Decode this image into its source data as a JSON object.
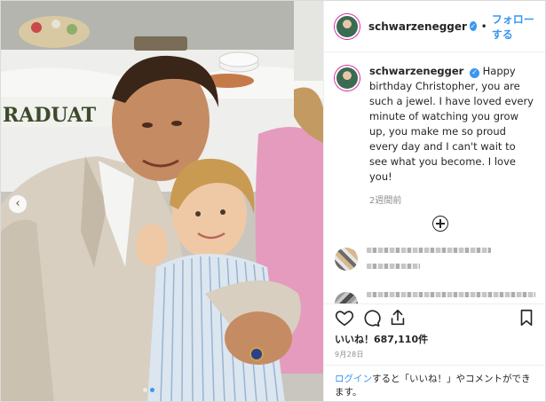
{
  "post": {
    "username": "schwarzenegger",
    "follow_label": "フォローする",
    "separator": "•",
    "caption_text": "Happy birthday Christopher, you are such a jewel. I have loved every minute of watching you grow up, you make me so proud every day and I can't wait to see what you become. I love you!",
    "posted_relative": "2週間前",
    "likes_label": "いいね！687,110件",
    "date_label": "9月28日",
    "login_link": "ログイン",
    "login_text": "すると「いいね！」やコメントができます。"
  },
  "colors": {
    "link_blue": "#3897f0",
    "text_dark": "#262626",
    "text_muted": "#8e8e8e"
  },
  "icons": {
    "verified": "verified-badge-icon",
    "like": "heart-icon",
    "comment": "comment-bubble-icon",
    "share": "share-icon",
    "save": "bookmark-icon",
    "more_comments": "plus-circle-icon",
    "carousel_prev": "chevron-left-icon"
  },
  "carousel": {
    "total": 2,
    "active_index": 1
  }
}
